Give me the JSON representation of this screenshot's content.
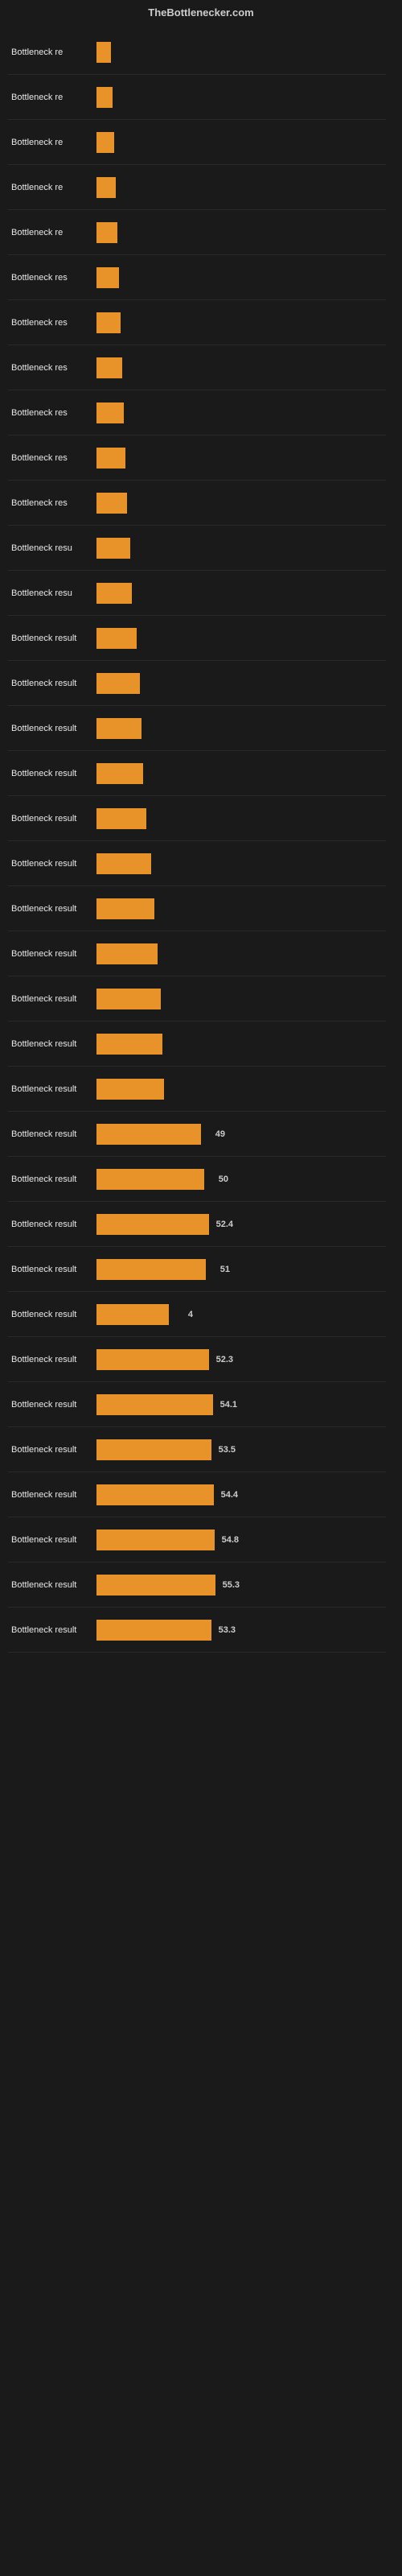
{
  "header": {
    "title": "TheBottlenecker.com"
  },
  "bars": [
    {
      "label": "Bottleneck re",
      "value": null,
      "width": 18
    },
    {
      "label": "Bottleneck re",
      "value": null,
      "width": 20
    },
    {
      "label": "Bottleneck re",
      "value": null,
      "width": 22
    },
    {
      "label": "Bottleneck re",
      "value": null,
      "width": 24
    },
    {
      "label": "Bottleneck re",
      "value": null,
      "width": 26
    },
    {
      "label": "Bottleneck res",
      "value": null,
      "width": 28
    },
    {
      "label": "Bottleneck res",
      "value": null,
      "width": 30
    },
    {
      "label": "Bottleneck res",
      "value": null,
      "width": 32
    },
    {
      "label": "Bottleneck res",
      "value": null,
      "width": 34
    },
    {
      "label": "Bottleneck res",
      "value": null,
      "width": 36
    },
    {
      "label": "Bottleneck res",
      "value": null,
      "width": 38
    },
    {
      "label": "Bottleneck resu",
      "value": null,
      "width": 42
    },
    {
      "label": "Bottleneck resu",
      "value": null,
      "width": 44
    },
    {
      "label": "Bottleneck result",
      "value": null,
      "width": 50
    },
    {
      "label": "Bottleneck result",
      "value": null,
      "width": 54
    },
    {
      "label": "Bottleneck result",
      "value": null,
      "width": 56
    },
    {
      "label": "Bottleneck result",
      "value": null,
      "width": 58
    },
    {
      "label": "Bottleneck result",
      "value": null,
      "width": 62
    },
    {
      "label": "Bottleneck result",
      "value": null,
      "width": 68
    },
    {
      "label": "Bottleneck result",
      "value": null,
      "width": 72
    },
    {
      "label": "Bottleneck result",
      "value": null,
      "width": 76
    },
    {
      "label": "Bottleneck result",
      "value": null,
      "width": 80
    },
    {
      "label": "Bottleneck result",
      "value": null,
      "width": 82
    },
    {
      "label": "Bottleneck result",
      "value": null,
      "width": 84
    },
    {
      "label": "Bottleneck result",
      "value": "49",
      "width": 130
    },
    {
      "label": "Bottleneck result",
      "value": "50",
      "width": 134
    },
    {
      "label": "Bottleneck result",
      "value": "52.4",
      "width": 140
    },
    {
      "label": "Bottleneck result",
      "value": "51",
      "width": 136
    },
    {
      "label": "Bottleneck result",
      "value": "4",
      "width": 90
    },
    {
      "label": "Bottleneck result",
      "value": "52.3",
      "width": 140
    },
    {
      "label": "Bottleneck result",
      "value": "54.1",
      "width": 145
    },
    {
      "label": "Bottleneck result",
      "value": "53.5",
      "width": 143
    },
    {
      "label": "Bottleneck result",
      "value": "54.4",
      "width": 146
    },
    {
      "label": "Bottleneck result",
      "value": "54.8",
      "width": 147
    },
    {
      "label": "Bottleneck result",
      "value": "55.3",
      "width": 148
    },
    {
      "label": "Bottleneck result",
      "value": "53.3",
      "width": 143
    }
  ]
}
